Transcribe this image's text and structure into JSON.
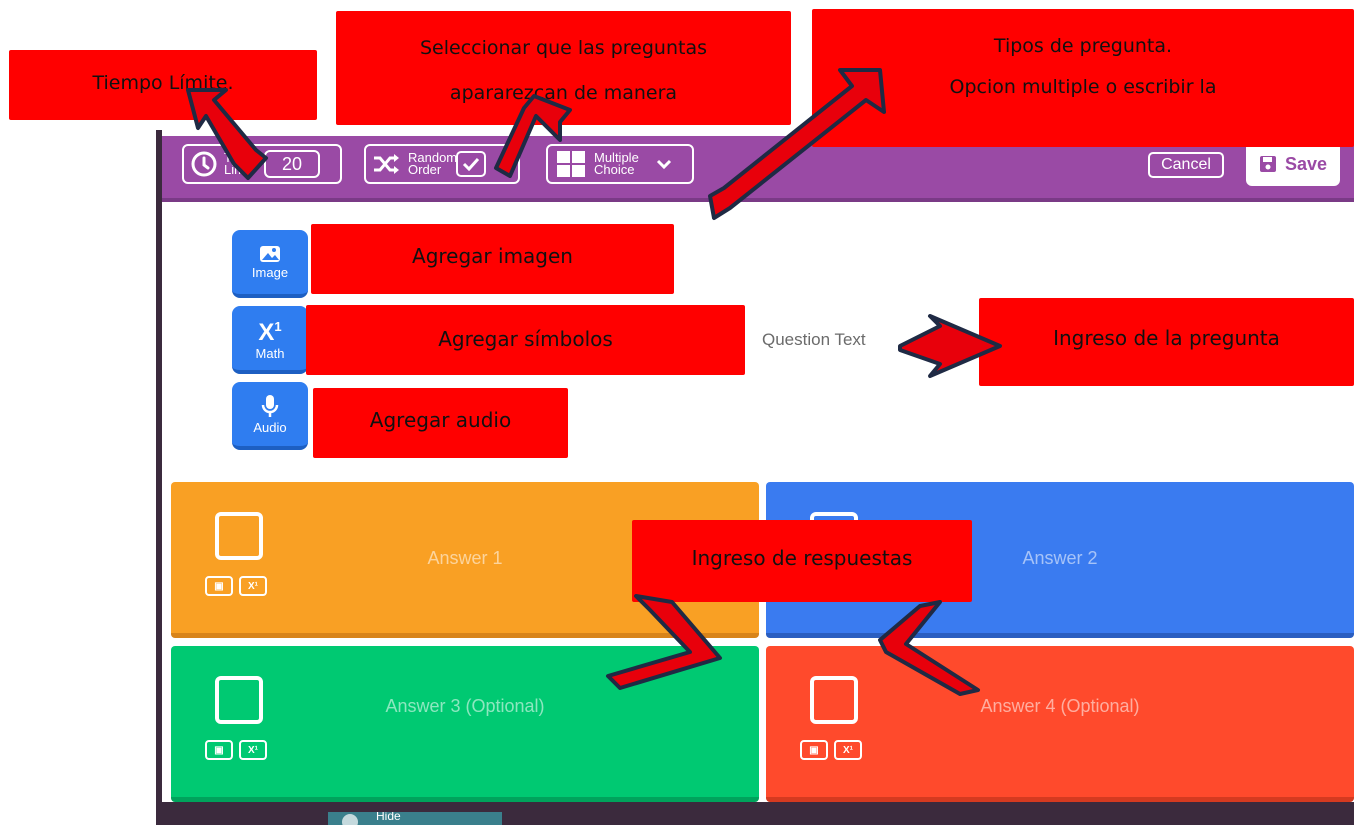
{
  "toolbar": {
    "time_label_1": "Time",
    "time_label_2": "Limit",
    "time_value": "20",
    "random_label_1": "Random",
    "random_label_2": "Order",
    "type_label_1": "Multiple",
    "type_label_2": "Choice",
    "cancel_label": "Cancel",
    "save_label": "Save"
  },
  "media": {
    "image_label": "Image",
    "math_label": "Math",
    "audio_label": "Audio"
  },
  "question": {
    "placeholder": "Question Text"
  },
  "answers": [
    {
      "placeholder": "Answer 1",
      "color": "#f9a024"
    },
    {
      "placeholder": "Answer 2",
      "color": "#3a7bf0"
    },
    {
      "placeholder": "Answer 3 (Optional)",
      "color": "#00c972"
    },
    {
      "placeholder": "Answer 4 (Optional)",
      "color": "#ff4a2c"
    }
  ],
  "footer": {
    "hide_label": "Hide"
  },
  "annotations": {
    "time_limit": "Tiempo Límite.",
    "random_line1": "Seleccionar que las preguntas",
    "random_line2": "apararezcan de manera",
    "types_line1": "Tipos de pregunta.",
    "types_line2": "Opcion multiple o escribir la",
    "add_image": "Agregar imagen",
    "add_symbols": "Agregar símbolos",
    "add_audio": "Agregar audio",
    "question_input": "Ingreso de la pregunta",
    "answers_input": "Ingreso de respuestas"
  },
  "colors": {
    "topbar": "#9a4aa5",
    "media_button": "#2f7df0",
    "callout": "#ff0000",
    "arrow_fill": "#e8000b",
    "arrow_outline": "#1f2a44"
  }
}
